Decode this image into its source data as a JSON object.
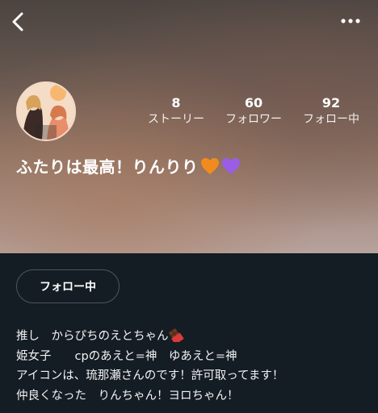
{
  "profile": {
    "display_name": "ふたりは最高！りんりり",
    "emoji_hearts": [
      "orange-heart",
      "purple-heart"
    ],
    "stats": [
      {
        "value": "8",
        "label": "ストーリー"
      },
      {
        "value": "60",
        "label": "フォロワー"
      },
      {
        "value": "92",
        "label": "フォロー中"
      }
    ],
    "follow_button_label": "フォロー中",
    "bio_lines": [
      "推し　からぴちのえとちゃん",
      "姫女子　　cpのあえと=神　ゆあえと=神",
      "アイコンは、琉那瀬さんのです！許可取ってます！",
      "仲良くなった　りんちゃん！ヨロちゃん！"
    ]
  },
  "colors": {
    "background": "#141c24",
    "orange_heart": "#f28b1e",
    "purple_heart": "#9b5de5"
  },
  "icons": {
    "back": "chevron-left-icon",
    "more": "more-horizontal-icon",
    "bio_emoji": "chocolate-bar-icon"
  }
}
